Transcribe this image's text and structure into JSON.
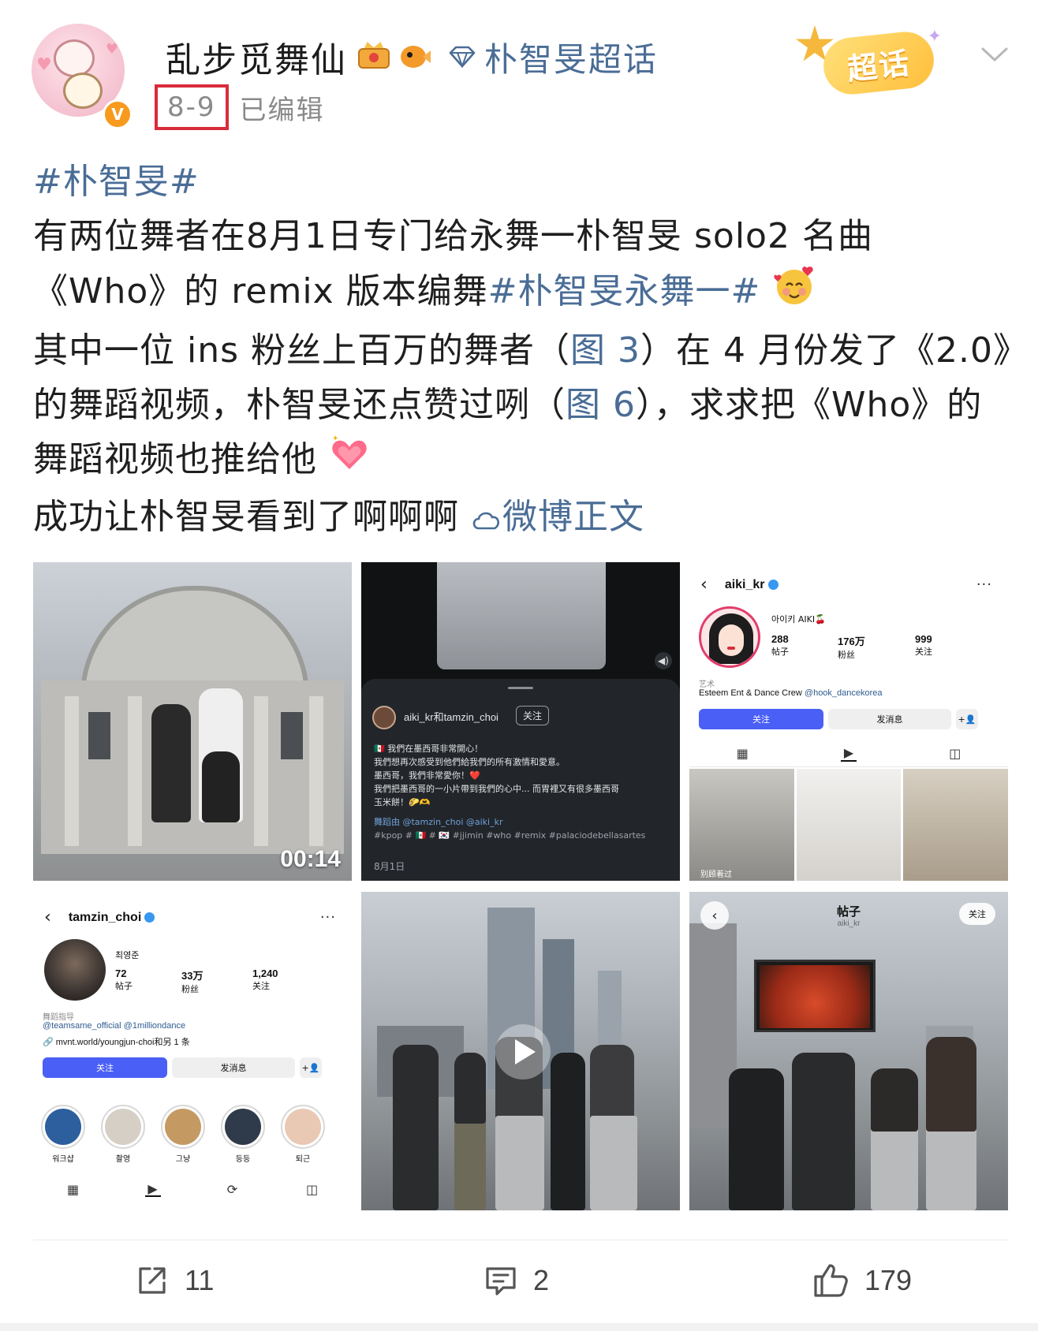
{
  "header": {
    "username": "乱步觅舞仙",
    "supertopic": "朴智旻超话",
    "time": "8-9",
    "edited": "已编辑",
    "badge_label": "超话",
    "verified_mark": "V"
  },
  "post": {
    "line1_tag": "#朴智旻#",
    "line2": "有两位舞者在8月1日专门给永舞一朴智旻 solo2 名曲",
    "line3_text": "《Who》的 remix 版本编舞",
    "line3_tag": "#朴智旻永舞一#",
    "line4_pre": "其中一位 ins 粉丝上百万的舞者（",
    "line4_link": "图 3",
    "line4_post": "）在 4 月份发了《2.0》",
    "line5_pre": "的舞蹈视频，朴智旻还点赞过咧（",
    "line5_link": "图 6",
    "line5_post": "），求求把《Who》的",
    "line6": "舞蹈视频也推给他",
    "line7_text": "成功让朴智旻看到了啊啊啊",
    "line7_link": "微博正文"
  },
  "images": {
    "img1": {
      "duration": "00:14"
    },
    "img2": {
      "user": "aiki_kr和tamzin_choi",
      "follow": "关注",
      "lines": [
        "🇲🇽 我們在墨西哥非常開心！",
        "我們想再次感受到他們給我們的所有激情和愛意。",
        "墨西哥，我們非常愛你！❤️",
        "我們把墨西哥的一小片帶到我們的心中... 而胃裡又有很多墨西哥",
        "玉米餅！🌮🫶"
      ],
      "credit": "舞蹈由 @tamzin_choi @aiki_kr",
      "tags": "#kpop # 🇲🇽 # 🇰🇷 #jjimin #who #remix #palaciodebellasartes",
      "date": "8月1日"
    },
    "img3": {
      "handle": "aiki_kr",
      "display": "아이키 AIKI🍒",
      "posts": "288",
      "posts_label": "帖子",
      "followers": "176万",
      "followers_label": "粉丝",
      "following": "999",
      "following_label": "关注",
      "category": "艺术",
      "bio": "Esteem Ent & Dance Crew",
      "bio_mention": "@hook_dancekorea",
      "follow": "关注",
      "message": "发消息",
      "thumb_label": "别顾着过"
    },
    "img4": {
      "handle": "tamzin_choi",
      "display": "최영준",
      "posts": "72",
      "posts_label": "帖子",
      "followers": "33万",
      "followers_label": "粉丝",
      "following": "1,240",
      "following_label": "关注",
      "category": "舞蹈指导",
      "mentions": "@teamsame_official @1milliondance",
      "link": "mvnt.world/youngjun-choi和另 1 条",
      "follow": "关注",
      "message": "发消息",
      "highlights": [
        "워크샵",
        "촬영",
        "그냥",
        "등등",
        "퇴근"
      ]
    },
    "img6": {
      "title": "帖子",
      "sub": "aiki_kr",
      "follow": "关注"
    }
  },
  "footer": {
    "shares": "11",
    "comments": "2",
    "likes": "179"
  },
  "colors": {
    "link": "#4a6d96",
    "highlight_box": "#d92b3a",
    "ig_button": "#4a5ff5"
  }
}
